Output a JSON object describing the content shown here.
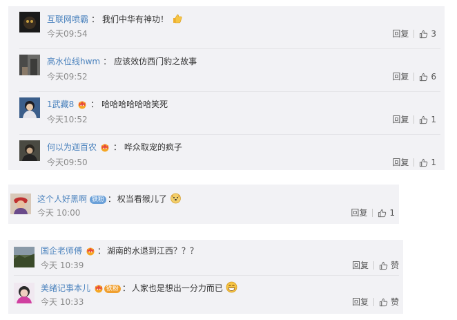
{
  "group1": {
    "comments": [
      {
        "user": "互联网喷霸",
        "text": "我们中华有神功！",
        "time": "今天09:54",
        "likes": "3",
        "has_badge": false,
        "text_emoji": "thumbs-up"
      },
      {
        "user": "高水位线hwm",
        "text": "应该效仿西门豹之故事",
        "time": "今天09:52",
        "likes": "6",
        "has_badge": false,
        "text_emoji": ""
      },
      {
        "user": "1武藏8",
        "text": "哈哈哈哈哈哈笑死",
        "time": "今天10:52",
        "likes": "1",
        "has_badge": true,
        "text_emoji": ""
      },
      {
        "user": "何以为迦百农",
        "text": "哗众取宠的疯子",
        "time": "今天09:50",
        "likes": "1",
        "has_badge": true,
        "text_emoji": ""
      }
    ],
    "reply_label": "回复"
  },
  "group2": {
    "comments": [
      {
        "user": "这个人好黑啊",
        "fan_badge": "铁粉",
        "text": "权当看猴儿了",
        "time": "今天 10:00",
        "likes": "1",
        "text_emoji": "dog-face"
      }
    ],
    "reply_label": "回复"
  },
  "group3": {
    "comments": [
      {
        "user": "国企老师傅",
        "text": "湖南的水退到江西？？？",
        "time": "今天 10:39",
        "likes": "赞",
        "has_badge": true,
        "fan_badge": "",
        "text_emoji": ""
      },
      {
        "user": "美绪记事本儿",
        "text": "人家也是想出一分力而已",
        "time": "今天 10:33",
        "likes": "赞",
        "has_badge": true,
        "fan_badge": "铁粉",
        "text_emoji": "grin-face"
      }
    ],
    "reply_label": "回复"
  },
  "icons": {
    "like": "thumbs-up-icon",
    "crown_badge": "member-crown-icon"
  },
  "colors": {
    "username": "#4a82bd",
    "time": "#8a8a8a",
    "panel_bg": "#f2f2f5",
    "fan_badge": "#6aa0d8"
  }
}
